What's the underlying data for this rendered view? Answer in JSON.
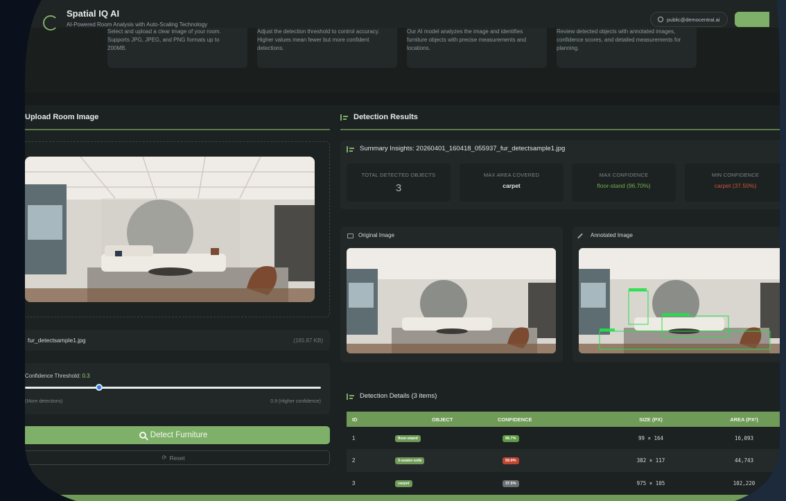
{
  "header": {
    "title": "Spatial IQ AI",
    "subtitle": "AI-Powered Room Analysis with Auto-Scaling Technology",
    "user_email": "public@democentral.ai"
  },
  "steps": [
    {
      "text": "Select and upload a clear image of your room. Supports JPG, JPEG, and PNG formats up to 200MB."
    },
    {
      "text": "Adjust the detection threshold to control accuracy. Higher values mean fewer but more confident detections."
    },
    {
      "text": "Our AI model analyzes the image and identifies furniture objects with precise measurements and locations."
    },
    {
      "text": "Review detected objects with annotated images, confidence scores, and detailed measurements for planning."
    }
  ],
  "upload": {
    "title": "Upload Room Image",
    "file_name": "fur_detectsample1.jpg",
    "file_size": "(165.87 KB)",
    "threshold_label": "Confidence Threshold:",
    "threshold_value": "0.3",
    "threshold_fraction": 0.3,
    "min_label": "(More detections)",
    "max_label": "0.9 (Higher confidence)",
    "detect_label": "Detect Furniture",
    "reset_label": "Reset"
  },
  "results": {
    "title": "Detection Results",
    "summary_title": "Summary Insights: 20260401_160418_055937_fur_detectsample1.jpg",
    "stats": [
      {
        "label": "TOTAL DETECTED OBJECTS",
        "value": "3"
      },
      {
        "label": "MAX AREA COVERED",
        "value": "carpet"
      },
      {
        "label": "MAX CONFIDENCE",
        "value": "floor-stand (96.70%)"
      },
      {
        "label": "MIN CONFIDENCE",
        "value": "carpet (37.50%)"
      }
    ],
    "original_title": "Original Image",
    "annotated_title": "Annotated Image",
    "details_title": "Detection Details (3 items)",
    "columns": [
      "ID",
      "OBJECT",
      "CONFIDENCE",
      "SIZE (PX)",
      "AREA (PX²)"
    ],
    "rows": [
      {
        "id": "1",
        "object": "floor-stand",
        "confidence": "96.7%",
        "conf_color": "#5f9a45",
        "size": "99 × 164",
        "area": "16,093"
      },
      {
        "id": "2",
        "object": "3-seater-sofa",
        "confidence": "59.9%",
        "conf_color": "#c0452f",
        "size": "382 × 117",
        "area": "44,743"
      },
      {
        "id": "3",
        "object": "carpet",
        "confidence": "37.5%",
        "conf_color": "#6b6f72",
        "size": "975 × 105",
        "area": "102,220"
      }
    ]
  },
  "colors": {
    "accent": "#7fb069",
    "danger": "#d0553a"
  }
}
